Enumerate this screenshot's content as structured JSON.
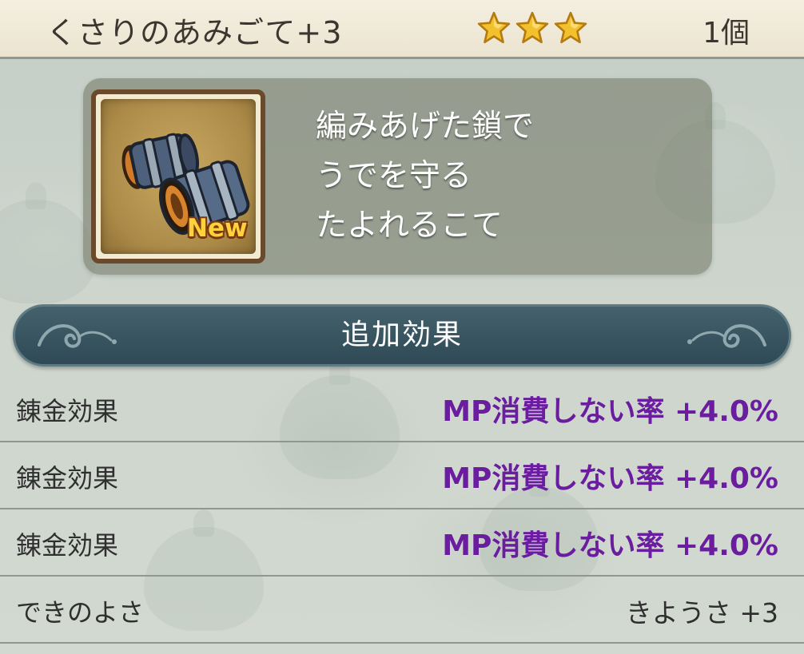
{
  "header": {
    "item_name": "くさりのあみごて+3",
    "stars": 3,
    "star_icon": "star-icon",
    "star_color": "#f2c12e",
    "count": "1個"
  },
  "item": {
    "icon": "chain-gauntlets-icon",
    "badge": "New",
    "description_lines": [
      "編みあげた鎖で",
      "うでを守る",
      "たよれるこて"
    ]
  },
  "section": {
    "title": "追加効果"
  },
  "effects": [
    {
      "label": "錬金効果",
      "value": "MP消費しない率 +4.0%",
      "highlight": true
    },
    {
      "label": "錬金効果",
      "value": "MP消費しない率 +4.0%",
      "highlight": true
    },
    {
      "label": "錬金効果",
      "value": "MP消費しない率 +4.0%",
      "highlight": true
    },
    {
      "label": "できのよさ",
      "value": "きようさ +3",
      "highlight": false
    }
  ],
  "colors": {
    "header_bg": "#f1ebd9",
    "panel_bg": "#7a7c68",
    "banner_bg": "#365260",
    "effect_highlight": "#6a1d9e",
    "text_dark": "#2f2f2f"
  }
}
